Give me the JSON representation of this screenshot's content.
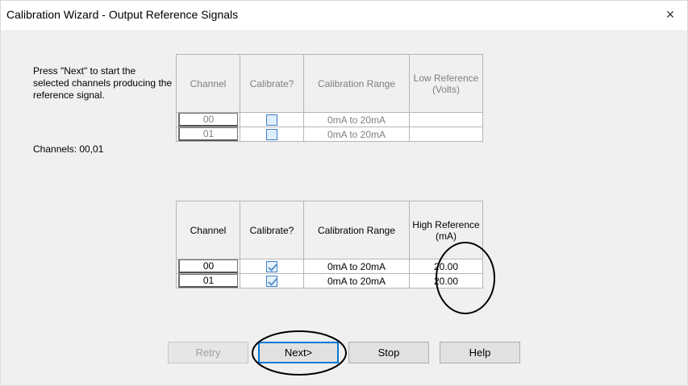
{
  "window": {
    "title": "Calibration Wizard - Output Reference Signals",
    "close_glyph": "×"
  },
  "instructions": "Press \"Next\" to start the selected channels producing the reference signal.",
  "channels_label": "Channels: 00,01",
  "low_table": {
    "headers": [
      "Channel",
      "Calibrate?",
      "Calibration Range",
      "Low Reference (Volts)"
    ],
    "rows": [
      {
        "channel": "00",
        "calibrate": false,
        "range": "0mA to 20mA",
        "reference": ""
      },
      {
        "channel": "01",
        "calibrate": false,
        "range": "0mA to 20mA",
        "reference": ""
      }
    ]
  },
  "high_table": {
    "headers": [
      "Channel",
      "Calibrate?",
      "Calibration Range",
      "High Reference (mA)"
    ],
    "rows": [
      {
        "channel": "00",
        "calibrate": true,
        "range": "0mA to 20mA",
        "reference": "20.00"
      },
      {
        "channel": "01",
        "calibrate": true,
        "range": "0mA to 20mA",
        "reference": "20.00"
      }
    ]
  },
  "buttons": {
    "retry": "Retry",
    "next": "Next>",
    "stop": "Stop",
    "help": "Help"
  },
  "colors": {
    "accent": "#0078d7",
    "annotation": "#000000"
  }
}
